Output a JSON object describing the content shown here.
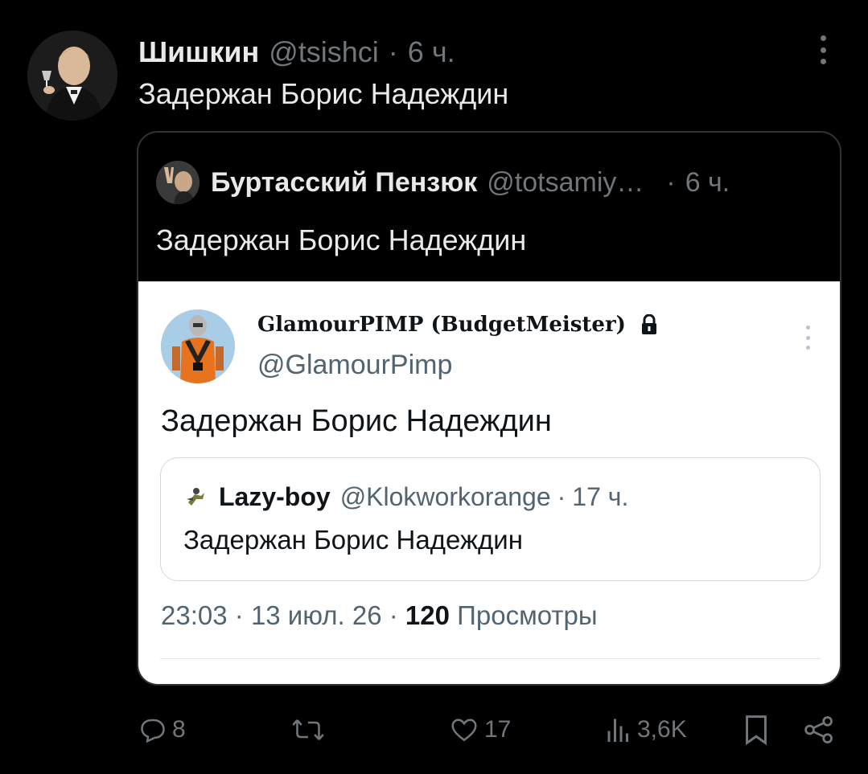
{
  "tweet": {
    "author_name": "Шишкин",
    "author_handle": "@tsishci",
    "separator": "·",
    "time": "6 ч.",
    "text": "Задержан Борис Надеждин"
  },
  "quoted": {
    "author_name": "Буртасский Пензюк",
    "author_handle": "@totsamiy…",
    "separator": "·",
    "time": "6 ч.",
    "text": "Задержан Борис Надеждин"
  },
  "screenshot": {
    "author_name": "GlamourPIMP (BudgetMeister)",
    "author_handle": "@GlamourPimp",
    "text": "Задержан Борис Надеждин",
    "inner_quote": {
      "author_name": "Lazy-boy",
      "author_handle": "@Klokworkorange",
      "separator": "·",
      "time": "17 ч.",
      "text": "Задержан Борис Надеждин"
    },
    "meta": {
      "time": "23:03",
      "date": "13 июл. 26",
      "views_count": "120",
      "views_label": "Просмотры",
      "separator": "·"
    }
  },
  "actions": {
    "replies": "8",
    "likes": "17",
    "views": "3,6K"
  },
  "colors": {
    "background": "#000000",
    "text_primary": "#e7e9ea",
    "text_muted": "#71767b",
    "card_border": "#2f3336"
  },
  "icons": [
    "more-icon",
    "reply-icon",
    "retweet-icon",
    "like-icon",
    "views-icon",
    "bookmark-icon",
    "share-icon",
    "lock-icon"
  ]
}
